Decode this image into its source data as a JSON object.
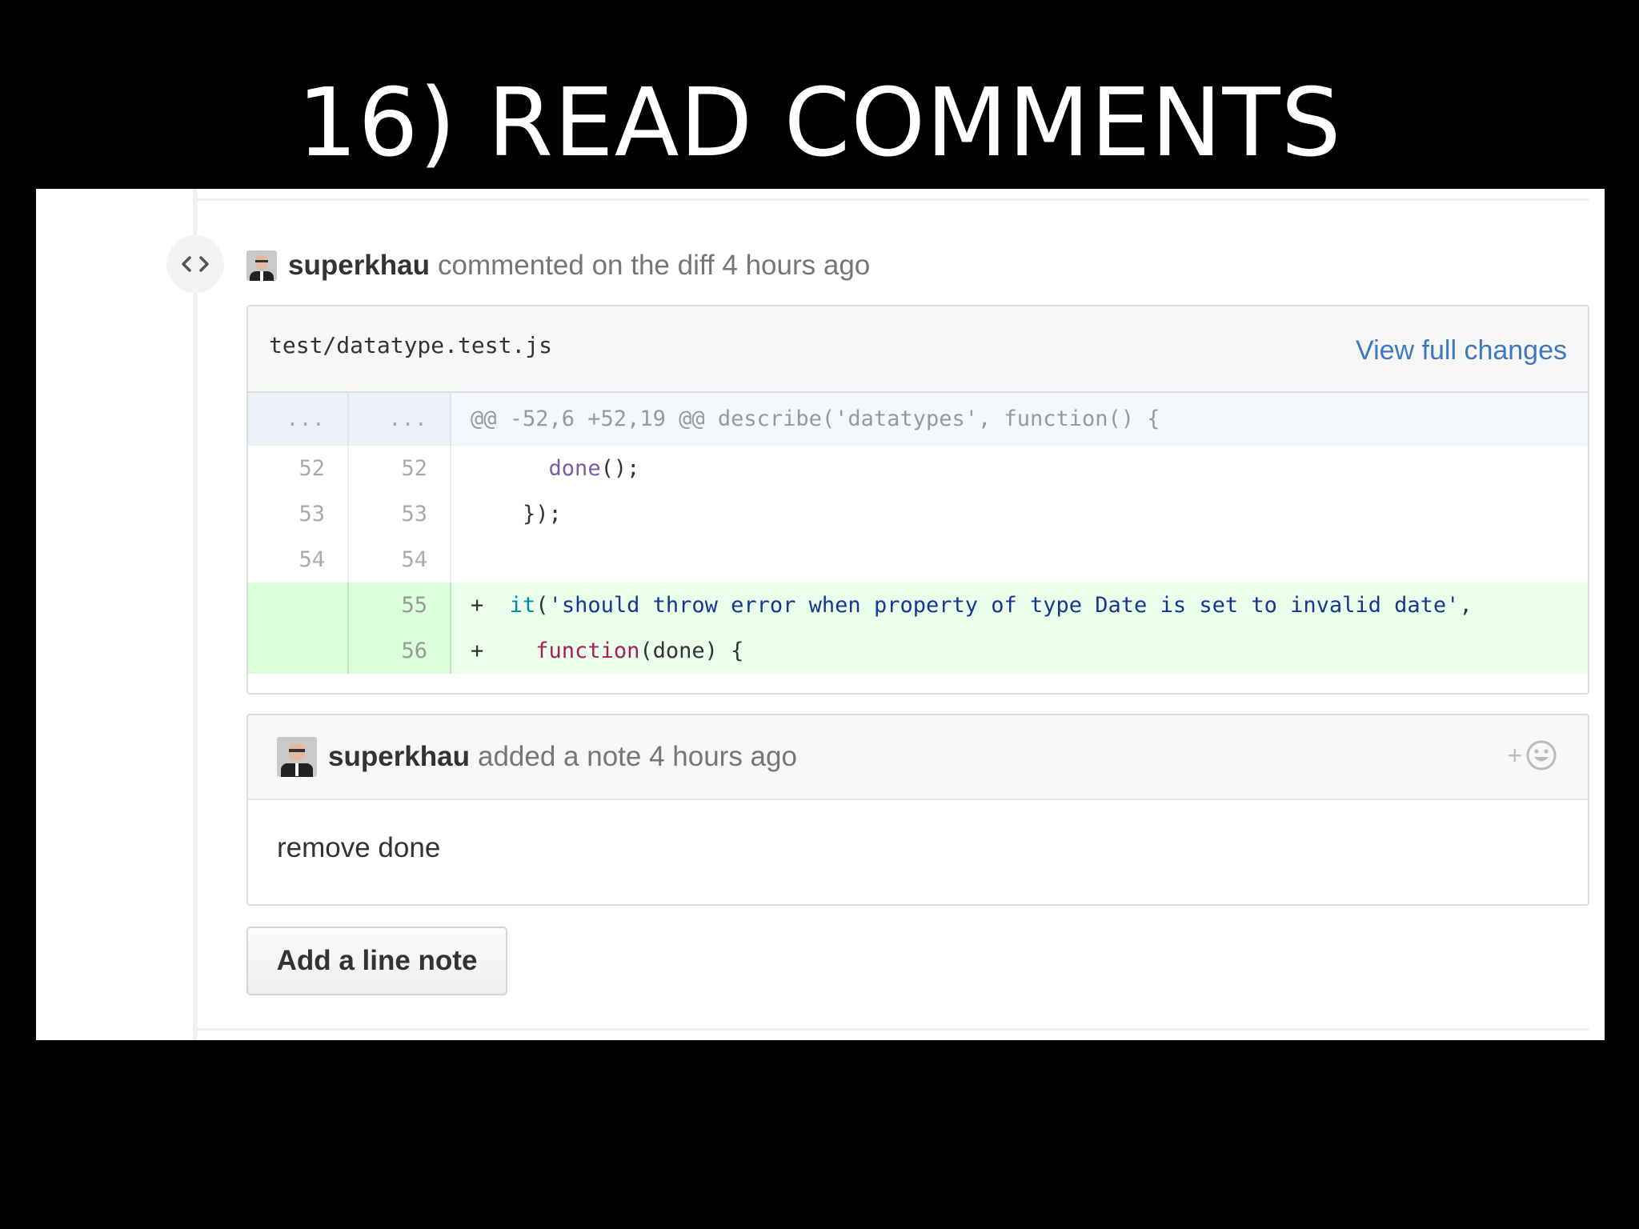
{
  "slide": {
    "title": "16) READ COMMENTS"
  },
  "comment": {
    "user": "superkhau",
    "action": "commented on the diff 4 hours ago"
  },
  "file": {
    "path": "test/datatype.test.js",
    "view_full_label": "View full changes"
  },
  "diff": {
    "hunk": {
      "old": "...",
      "new": "...",
      "text": "@@ -52,6 +52,19 @@ describe('datatypes', function() {"
    },
    "lines": [
      {
        "old": "52",
        "new": "52",
        "indent": "      ",
        "fn": "done",
        "rest": "();"
      },
      {
        "old": "53",
        "new": "53",
        "text": "    });"
      },
      {
        "old": "54",
        "new": "54",
        "text": ""
      },
      {
        "old": "",
        "new": "55",
        "marker": "+",
        "indent": "  ",
        "fn": "it",
        "open": "(",
        "string": "'should throw error when property of type Date is set to invalid date'",
        "close": ","
      },
      {
        "old": "",
        "new": "56",
        "marker": "+",
        "indent": "    ",
        "keyword": "function",
        "rest": "(done) {"
      }
    ]
  },
  "note": {
    "user": "superkhau",
    "action": "added a note 4 hours ago",
    "reaction_plus": "+",
    "body": "remove done"
  },
  "add_line_note_label": "Add a line note",
  "icons": {
    "badge": "code-brackets-icon",
    "reaction": "smiley-icon"
  }
}
